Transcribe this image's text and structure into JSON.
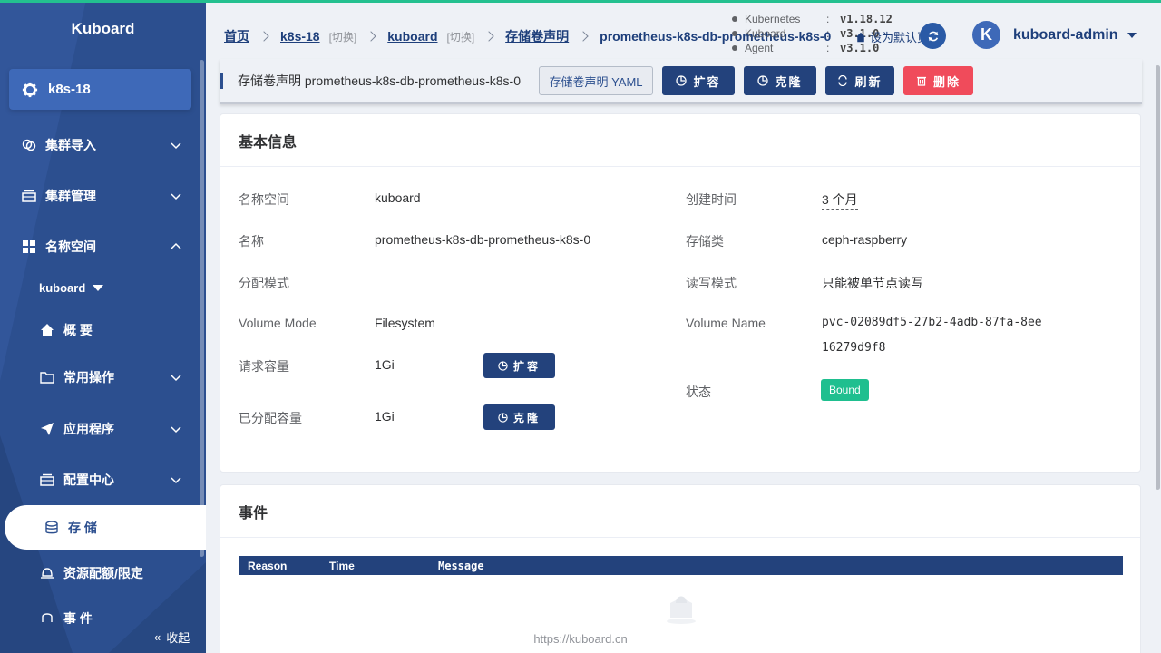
{
  "app": {
    "name": "Kuboard",
    "cluster": "k8s-18"
  },
  "sidebar": {
    "items": [
      {
        "label": "集群导入",
        "icon": "link-icon"
      },
      {
        "label": "集群管理",
        "icon": "server-icon"
      },
      {
        "label": "名称空间",
        "icon": "grid-icon"
      },
      {
        "label": "概 要",
        "icon": "home-icon"
      },
      {
        "label": "常用操作",
        "icon": "folder-icon"
      },
      {
        "label": "应用程序",
        "icon": "send-icon"
      },
      {
        "label": "配置中心",
        "icon": "server-icon"
      },
      {
        "label": "存 储",
        "icon": "database-icon"
      },
      {
        "label": "资源配额/限定",
        "icon": "bell-icon"
      },
      {
        "label": "事 件",
        "icon": "event-icon"
      }
    ],
    "namespace": "kuboard",
    "collapse_label": "收起"
  },
  "breadcrumb": {
    "home": "首页",
    "cluster": "k8s-18",
    "cluster_switch": "[切换]",
    "namespace": "kuboard",
    "namespace_switch": "[切换]",
    "section": "存储卷声明",
    "current": "prometheus-k8s-db-prometheus-k8s-0"
  },
  "versions": [
    {
      "name": "Kubernetes",
      "value": "v1.18.12"
    },
    {
      "name": "Kuboard",
      "value": "v3.1.0"
    },
    {
      "name": "Agent",
      "value": "v3.1.0"
    }
  ],
  "header": {
    "set_default_label": "设为默认页",
    "username": "kuboard-admin",
    "avatar_letter": "K"
  },
  "toolbar": {
    "title": "存储卷声明 prometheus-k8s-db-prometheus-k8s-0",
    "yaml_label": "存储卷声明 YAML",
    "expand_label": "扩容",
    "clone_label": "克隆",
    "refresh_label": "刷新",
    "delete_label": "删除"
  },
  "basic_info": {
    "title": "基本信息",
    "left": [
      {
        "label": "名称空间",
        "value": "kuboard"
      },
      {
        "label": "名称",
        "value": "prometheus-k8s-db-prometheus-k8s-0"
      },
      {
        "label": "分配模式",
        "value": ""
      },
      {
        "label": "Volume Mode",
        "value": "Filesystem"
      },
      {
        "label": "请求容量",
        "value": "1Gi"
      },
      {
        "label": "已分配容量",
        "value": "1Gi"
      }
    ],
    "right": [
      {
        "label": "创建时间",
        "value": "3 个月"
      },
      {
        "label": "存储类",
        "value": "ceph-raspberry"
      },
      {
        "label": "读写模式",
        "value": "只能被单节点读写"
      },
      {
        "label": "Volume Name",
        "value": "pvc-02089df5-27b2-4adb-87fa-8ee16279d9f8"
      },
      {
        "label": "状态",
        "value": "Bound"
      }
    ],
    "expand_btn": "扩容",
    "clone_btn": "克隆"
  },
  "events": {
    "title": "事件",
    "columns": [
      "Reason",
      "Time",
      "Message"
    ]
  },
  "footer": {
    "url": "https://kuboard.cn"
  },
  "colors": {
    "sidebar": "#2c4f8f",
    "primary": "#23427c",
    "danger": "#f04b5b",
    "success": "#1fbf8f",
    "accent": "#23c08f"
  }
}
